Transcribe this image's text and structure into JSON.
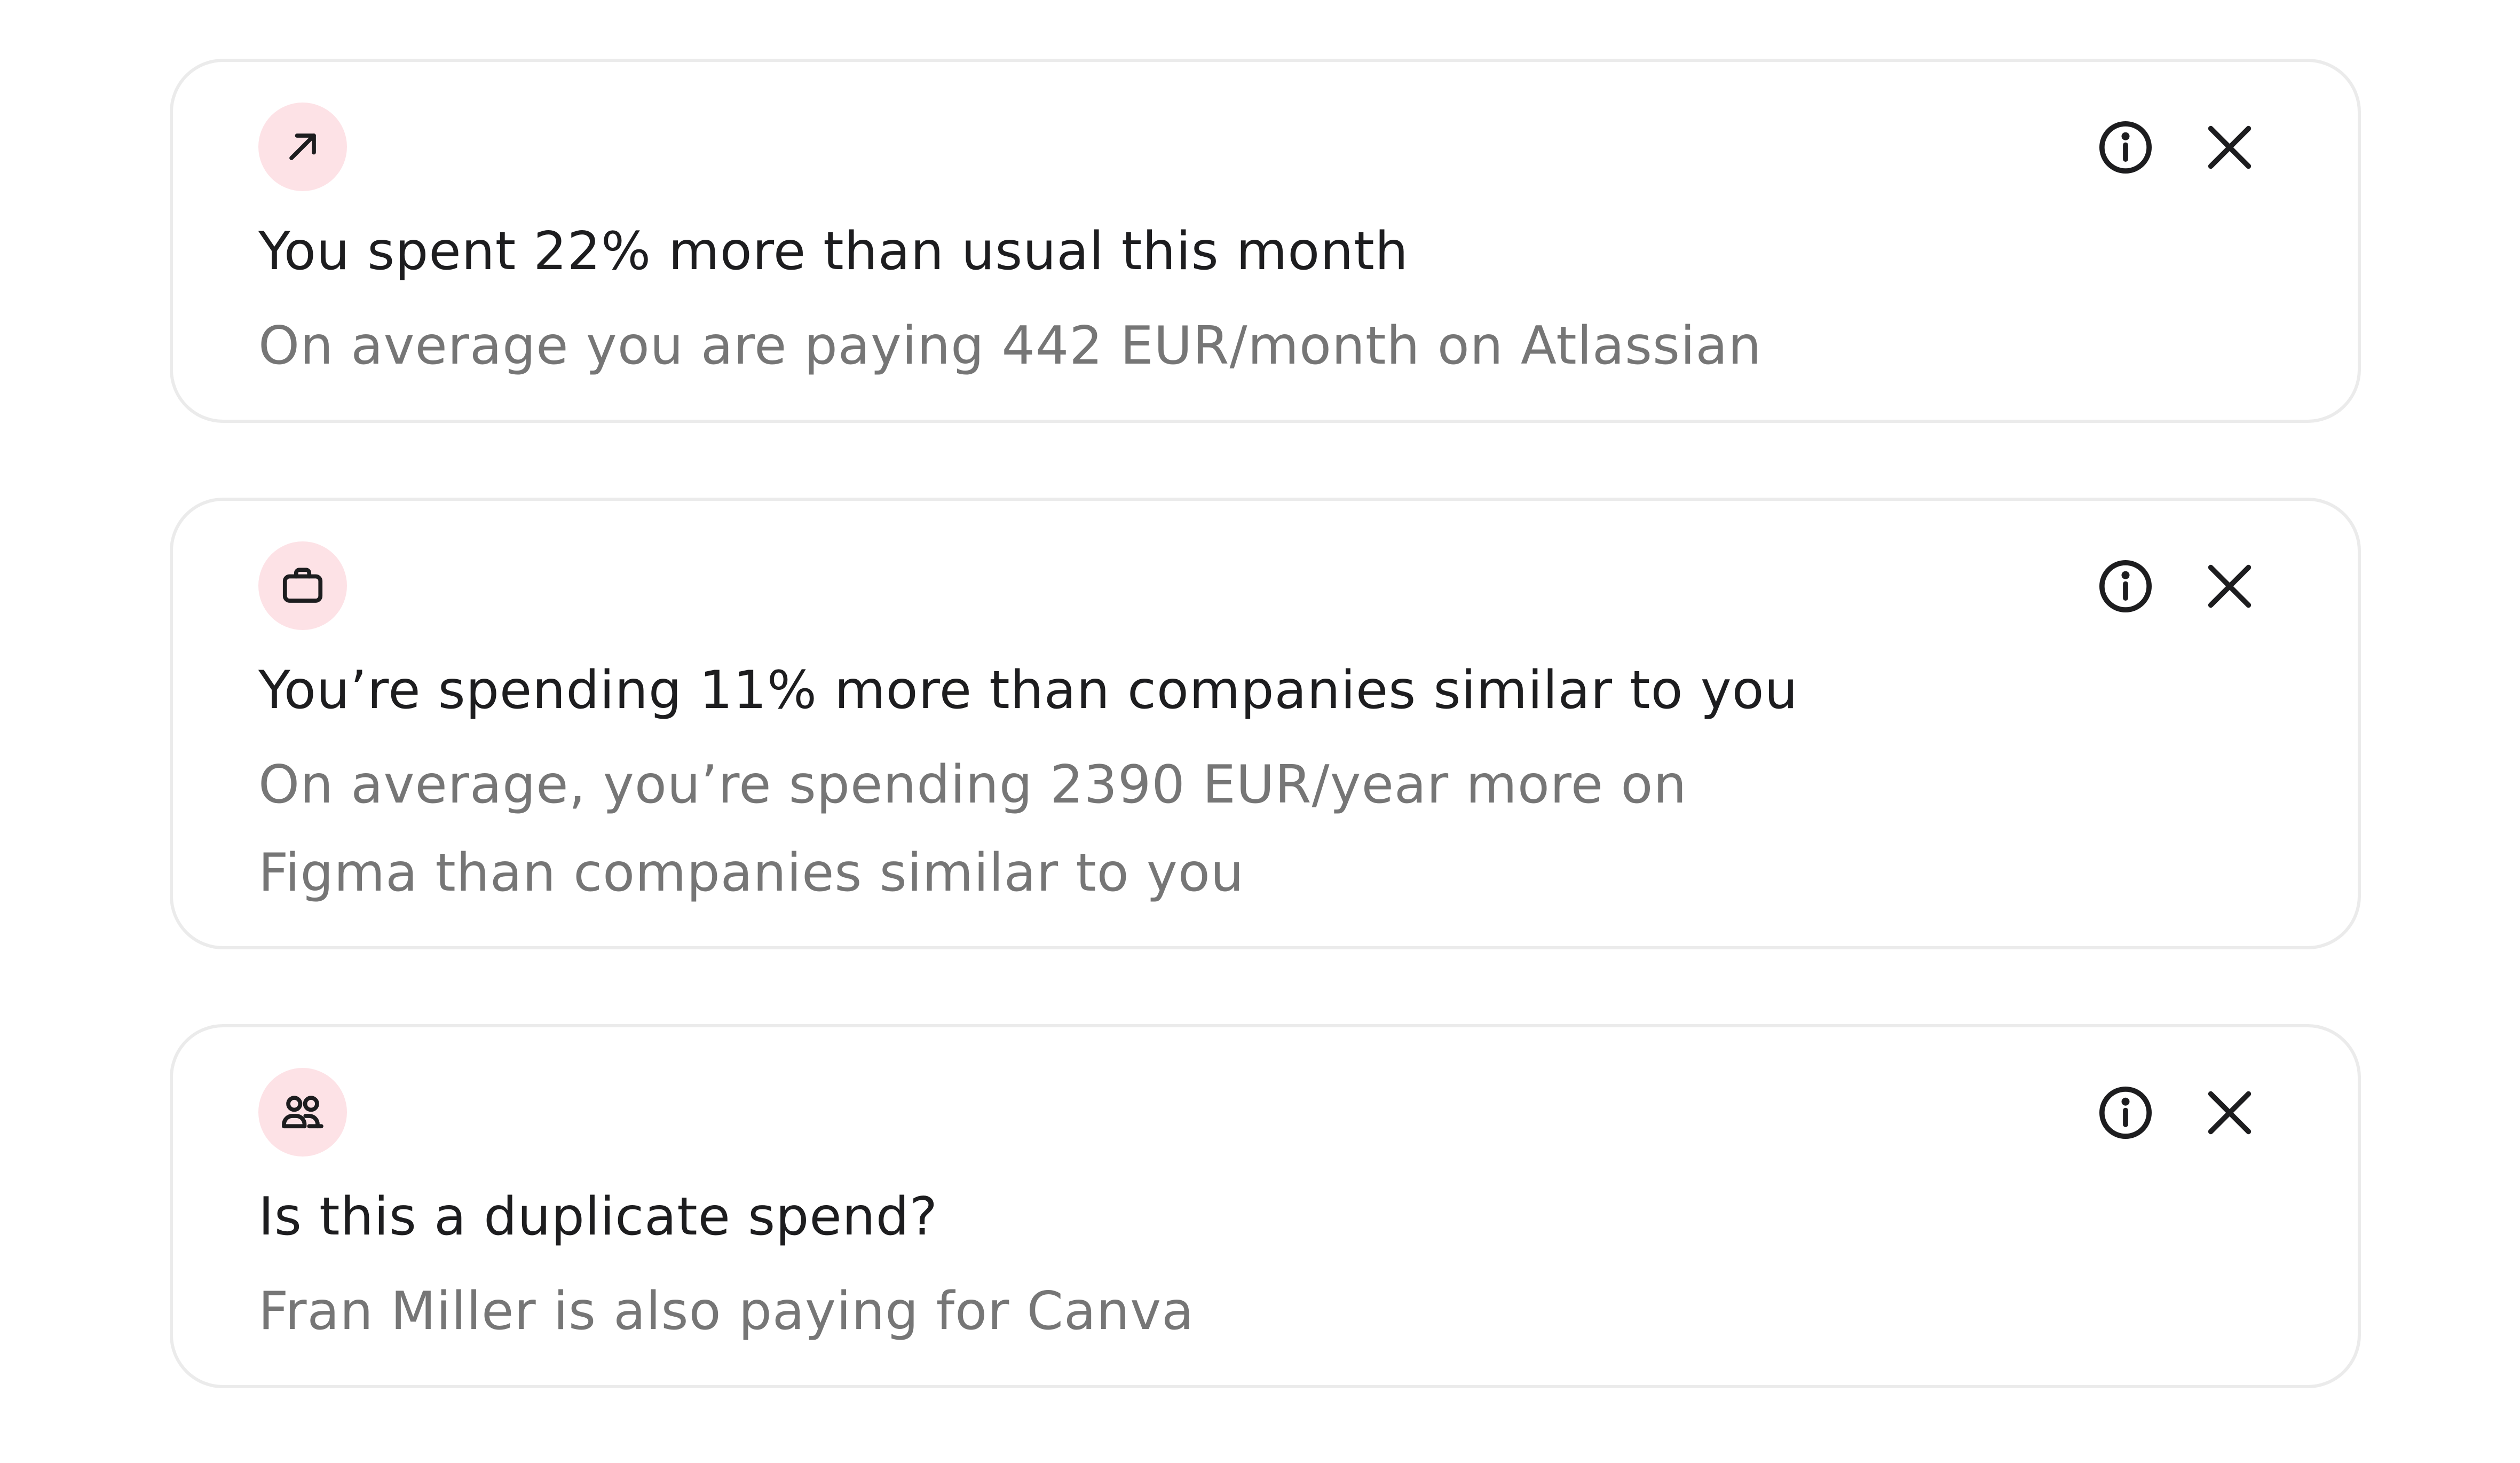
{
  "insights": [
    {
      "icon": "arrow-up-right-icon",
      "title": "You spent 22% more than usual this month",
      "description": "On average you are paying 442 EUR/month on Atlassian"
    },
    {
      "icon": "briefcase-icon",
      "title": "You’re spending 11% more than companies similar to you",
      "description": "On average, you’re spending 2390 EUR/year more on Figma than companies similar to you"
    },
    {
      "icon": "users-icon",
      "title": "Is this a duplicate spend?",
      "description": "Fran Miller is also paying for Canva"
    }
  ],
  "colors": {
    "badge_background": "#fde2e6",
    "card_border": "#ebebeb",
    "title_text": "#1d1d1f",
    "description_text": "#767676",
    "icon_stroke": "#1d1d1f"
  }
}
